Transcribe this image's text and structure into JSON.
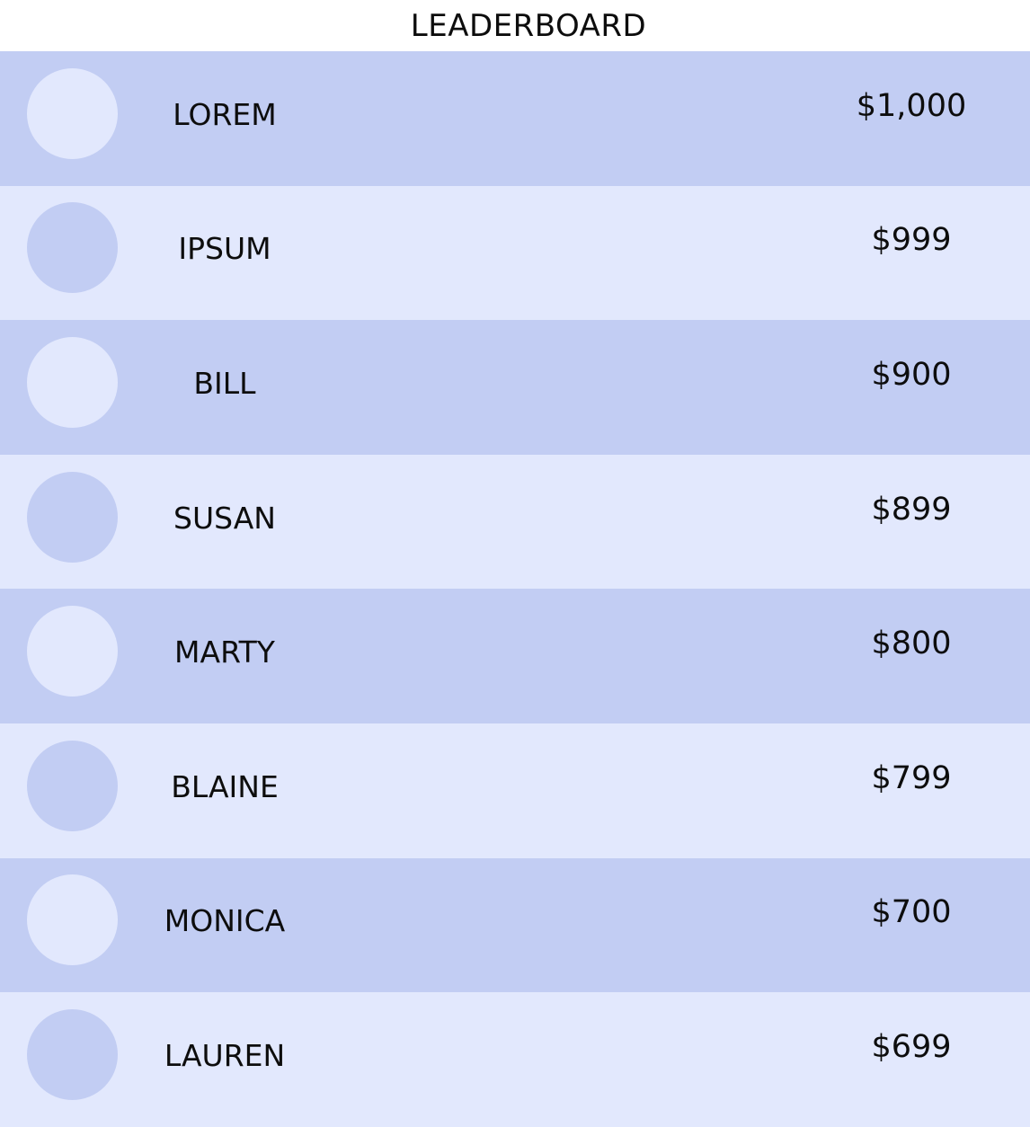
{
  "header": {
    "title": "LEADERBOARD"
  },
  "colors": {
    "row_dark": "#c2cdf3",
    "row_light": "#e2e8fd"
  },
  "entries": [
    {
      "name": "LOREM",
      "amount": "$1,000"
    },
    {
      "name": "IPSUM",
      "amount": "$999"
    },
    {
      "name": "BILL",
      "amount": "$900"
    },
    {
      "name": "SUSAN",
      "amount": "$899"
    },
    {
      "name": "MARTY",
      "amount": "$800"
    },
    {
      "name": "BLAINE",
      "amount": "$799"
    },
    {
      "name": "MONICA",
      "amount": "$700"
    },
    {
      "name": "LAUREN",
      "amount": "$699"
    }
  ]
}
